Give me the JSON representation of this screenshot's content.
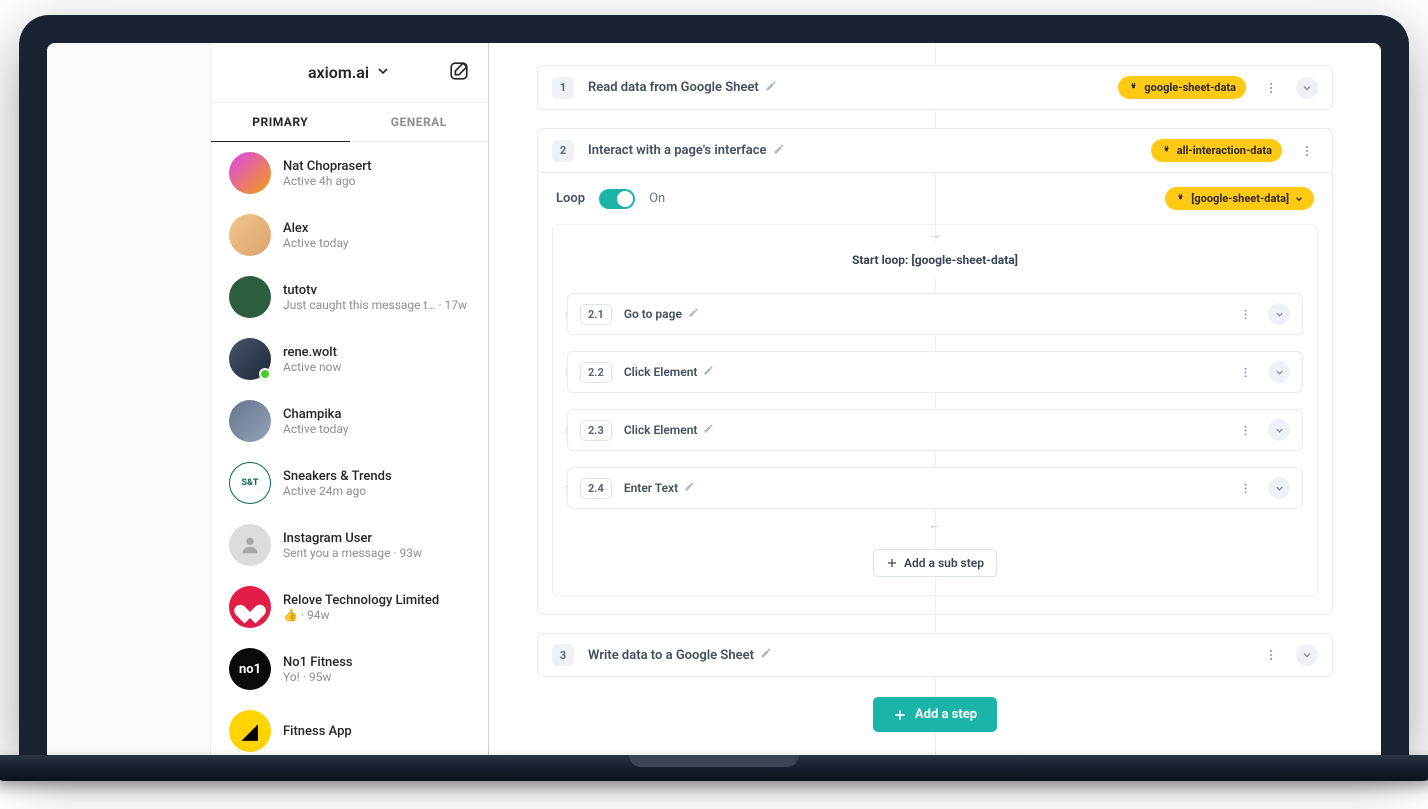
{
  "dm": {
    "account": "axiom.ai",
    "tabs": {
      "primary": "PRIMARY",
      "general": "GENERAL"
    },
    "items": [
      {
        "name": "Nat Choprasert",
        "status": "Active 4h ago"
      },
      {
        "name": "Alex",
        "status": "Active today"
      },
      {
        "name": "tutotv",
        "status": "Just caught this message t…  · 17w"
      },
      {
        "name": "rene.wolt",
        "status": "Active now"
      },
      {
        "name": "Champika",
        "status": "Active today"
      },
      {
        "name": "Sneakers & Trends",
        "status": "Active 24m ago"
      },
      {
        "name": "Instagram User",
        "status": "Sent you a message · 93w"
      },
      {
        "name": "Relove Technology Limited",
        "status": "👍 · 94w"
      },
      {
        "name": "No1 Fitness",
        "status": "Yo! · 95w"
      },
      {
        "name": "Fitness App",
        "status": ""
      }
    ]
  },
  "builder": {
    "step1": {
      "num": "1",
      "title": "Read data from Google Sheet",
      "badge": "google-sheet-data"
    },
    "step2": {
      "num": "2",
      "title": "Interact with a page's interface",
      "badge": "all-interaction-data",
      "loopLabel": "Loop",
      "loopState": "On",
      "loopDataBadge": "[google-sheet-data]",
      "startLoop": "Start loop: [google-sheet-data]",
      "subs": [
        {
          "num": "2.1",
          "title": "Go to page"
        },
        {
          "num": "2.2",
          "title": "Click Element"
        },
        {
          "num": "2.3",
          "title": "Click Element"
        },
        {
          "num": "2.4",
          "title": "Enter Text"
        }
      ],
      "addSub": "Add a sub step"
    },
    "step3": {
      "num": "3",
      "title": "Write data to a Google Sheet"
    },
    "addStep": "Add a step"
  }
}
